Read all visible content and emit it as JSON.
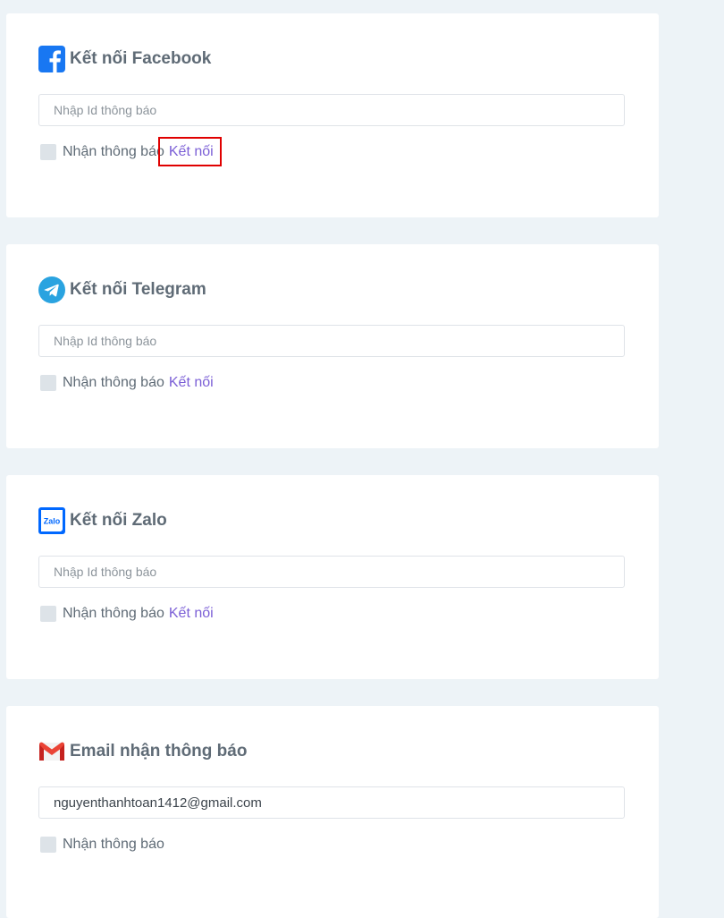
{
  "facebook": {
    "title": "Kết nối Facebook",
    "input_placeholder": "Nhập Id thông báo",
    "checkbox_label": "Nhận thông báo",
    "connect_link": "Kết nối"
  },
  "telegram": {
    "title": "Kết nối Telegram",
    "input_placeholder": "Nhập Id thông báo",
    "checkbox_label": "Nhận thông báo",
    "connect_link": "Kết nối"
  },
  "zalo": {
    "title": "Kết nối Zalo",
    "icon_text": "Zalo",
    "input_placeholder": "Nhập Id thông báo",
    "checkbox_label": "Nhận thông báo",
    "connect_link": "Kết nối"
  },
  "email": {
    "title": "Email nhận thông báo",
    "input_value": "nguyenthanhtoan1412@gmail.com",
    "checkbox_label": "Nhận thông báo"
  },
  "icons": {
    "facebook": "facebook-icon",
    "telegram": "telegram-icon",
    "zalo": "zalo-icon",
    "gmail": "gmail-icon"
  },
  "colors": {
    "page_background": "#edf3f7",
    "link": "#7b5fd6",
    "highlight_border": "#e00000",
    "facebook_blue": "#1877f2",
    "telegram_blue": "#2aa3e0",
    "zalo_blue": "#0068ff",
    "gmail_red": "#ea4335"
  }
}
